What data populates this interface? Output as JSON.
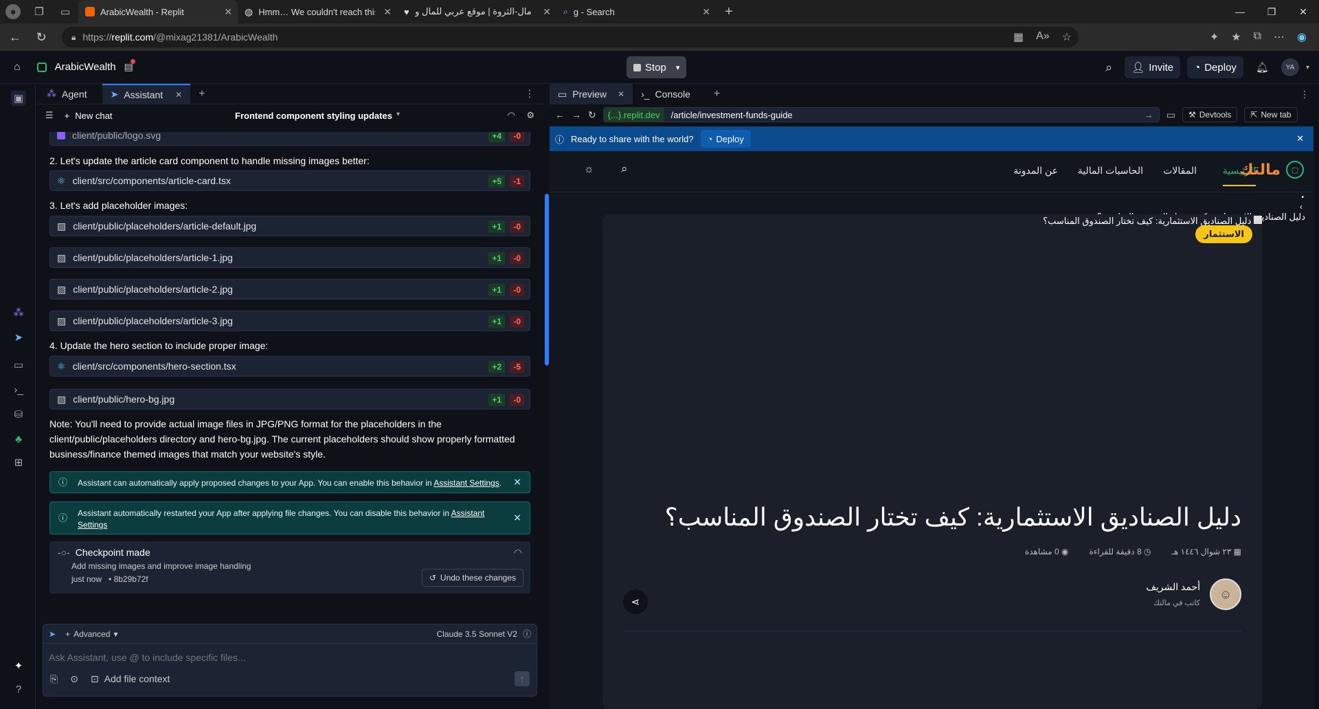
{
  "browser": {
    "tabs": [
      {
        "title": "ArabicWealth - Replit",
        "active": true
      },
      {
        "title": "Hmm… We couldn't reach this app",
        "active": false
      },
      {
        "title": "مال-الثروة | موقع عربي للمال والأعمال",
        "active": false
      },
      {
        "title": "g - Search",
        "active": false
      }
    ],
    "url_scheme": "https://",
    "url_host": "replit.com",
    "url_path": "/@mixag21381/ArabicWealth"
  },
  "replit": {
    "repl_name": "ArabicWealth",
    "stop_label": "Stop",
    "invite_label": "Invite",
    "deploy_label": "Deploy",
    "avatar_initials": "YA"
  },
  "left_panel": {
    "tabs": [
      {
        "label": "Agent"
      },
      {
        "label": "Assistant"
      }
    ],
    "new_chat": "New chat",
    "chat_title": "Frontend component styling updates",
    "messages": {
      "file0": {
        "path": "client/public/logo.svg",
        "add": "+4",
        "del": "-0"
      },
      "step2": "2. Let's update the article card component to handle missing images better:",
      "file1": {
        "path": "client/src/components/article-card.tsx",
        "add": "+5",
        "del": "-1"
      },
      "step3": "3. Let's add placeholder images:",
      "file2": {
        "path": "client/public/placeholders/article-default.jpg",
        "add": "+1",
        "del": "-0"
      },
      "file3": {
        "path": "client/public/placeholders/article-1.jpg",
        "add": "+1",
        "del": "-0"
      },
      "file4": {
        "path": "client/public/placeholders/article-2.jpg",
        "add": "+1",
        "del": "-0"
      },
      "file5": {
        "path": "client/public/placeholders/article-3.jpg",
        "add": "+1",
        "del": "-0"
      },
      "step4": "4. Update the hero section to include proper image:",
      "file6": {
        "path": "client/src/components/hero-section.tsx",
        "add": "+2",
        "del": "-5"
      },
      "file7": {
        "path": "client/public/hero-bg.jpg",
        "add": "+1",
        "del": "-0"
      },
      "note": "Note: You'll need to provide actual image files in JPG/PNG format for the placeholders in the client/public/placeholders directory and hero-bg.jpg. The current placeholders should show properly formatted business/finance themed images that match your website's style.",
      "notice1_text": "Assistant can automatically apply proposed changes to your App. You can enable this behavior in ",
      "notice1_link": "Assistant Settings",
      "notice2_text": "Assistant automatically restarted your App after applying file changes. You can disable this behavior in ",
      "notice2_link": "Assistant Settings",
      "checkpoint_title": "Checkpoint made",
      "checkpoint_desc": "Add missing images and improve image handling",
      "checkpoint_time": "just now",
      "checkpoint_hash": "8b29b72f",
      "undo_label": "Undo these changes"
    },
    "composer": {
      "advanced_label": "Advanced",
      "model": "Claude 3.5 Sonnet V2",
      "placeholder": "Ask Assistant, use @ to include specific files...",
      "add_context": "Add file context"
    }
  },
  "right_panel": {
    "tabs": [
      {
        "label": "Preview"
      },
      {
        "label": "Console"
      }
    ],
    "dev_domain": "{...}.replit.dev",
    "path": "/article/investment-funds-guide",
    "devtools_label": "Devtools",
    "newtab_label": "New tab",
    "share_text": "Ready to share with the world?",
    "share_deploy": "Deploy",
    "site": {
      "logo": "مالتك",
      "nav": [
        "الرئيسية",
        "المقالات",
        "الحاسبات المالية",
        "عن المدونة"
      ],
      "breadcrumb_title": "دليل الصناديق الاستثمارية: كيف تختار الصندوق المناسب؟",
      "img_alt": "دليل الصناديق الاستثمارية: كيف تختار الصندوق المناسب؟",
      "category": "الاستثمار",
      "title": "دليل الصناديق الاستثمارية: كيف تختار الصندوق المناسب؟",
      "date": "٢٣ شوال ١٤٤٦ هـ",
      "read_time": "8 دقيقة للقراءة",
      "views": "0 مشاهدة",
      "author_name": "أحمد الشريف",
      "author_role": "كاتب في مالتك"
    }
  },
  "colors": {
    "accent_blue": "#2b7fff",
    "add_green": "#4ccf6e",
    "del_red": "#ff6b6b",
    "tag_yellow": "#f5c518",
    "logo_orange": "#f0883e",
    "nav_active": "#2bb673"
  }
}
